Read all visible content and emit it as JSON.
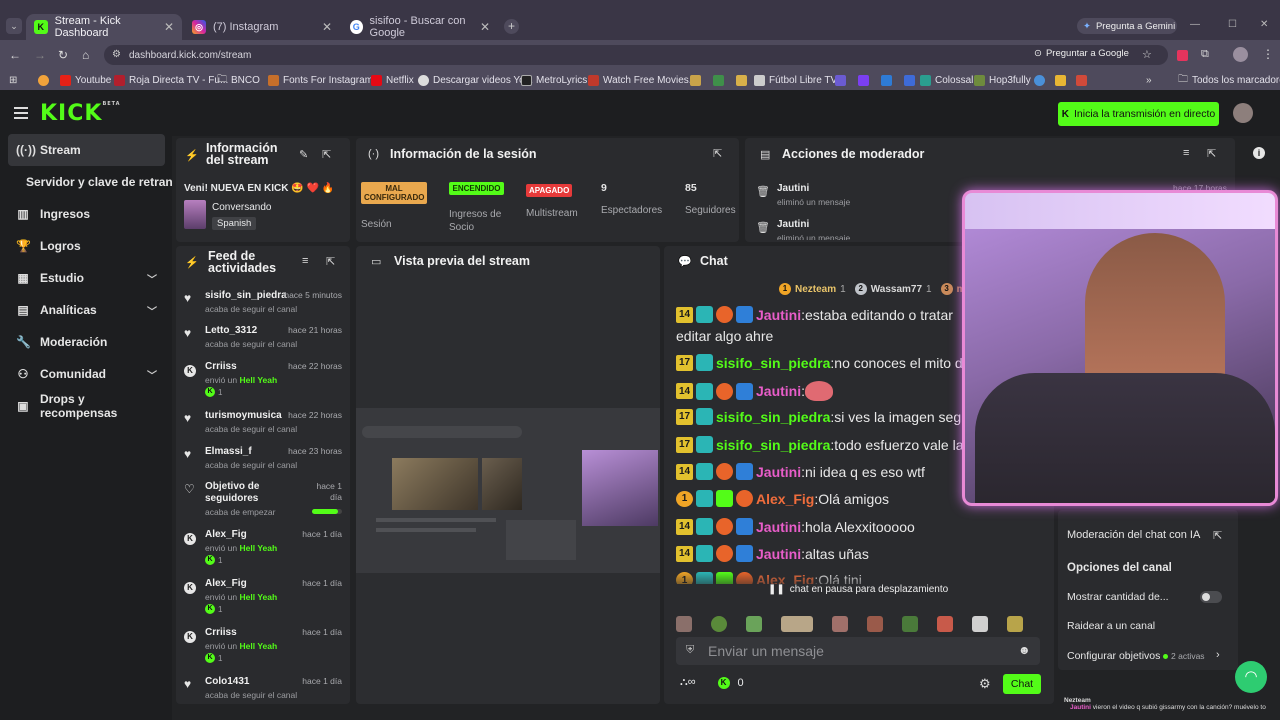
{
  "browser": {
    "tabs": [
      {
        "title": "Stream - Kick Dashboard"
      },
      {
        "title": "(7) Instagram"
      },
      {
        "title": "sisifoo - Buscar con Google"
      }
    ],
    "gemini_button": "Pregunta a Gemini",
    "url": "dashboard.kick.com/stream",
    "ask_google": "Preguntar a Google",
    "bookmarks": [
      "Youtube",
      "Roja Directa TV - Fu...",
      "BNCO",
      "Fonts For Instagram...",
      "Netflix",
      "Descargar videos Yo...",
      "MetroLyrics",
      "Watch Free Movies...",
      "Fútbol Libre TV",
      "Colossal",
      "Hop3fully",
      "Todos los marcadores"
    ]
  },
  "app": {
    "logo": "KICK",
    "logo_beta": "BETA",
    "go_live_button": "Inicia la transmisión en directo",
    "accent": "#53fc18"
  },
  "sidebar": {
    "items": [
      {
        "label": "Stream"
      },
      {
        "label": "Servidor y clave de retransn"
      },
      {
        "label": "Ingresos"
      },
      {
        "label": "Logros"
      },
      {
        "label": "Estudio"
      },
      {
        "label": "Analíticas"
      },
      {
        "label": "Moderación"
      },
      {
        "label": "Comunidad"
      },
      {
        "label": "Drops y recompensas"
      }
    ]
  },
  "stream_info": {
    "title_line1": "Información",
    "title_line2": "del stream",
    "stream_title": "Veni! NUEVA EN KICK 🤩 ❤️ 🔥",
    "category": "Conversando",
    "language": "Spanish"
  },
  "session": {
    "title": "Información de la sesión",
    "stats": [
      {
        "badge": "MAL CONFIGURADO",
        "label": "Sesión"
      },
      {
        "badge": "ENCENDIDO",
        "label": "Ingresos de Socio"
      },
      {
        "badge": "APAGADO",
        "label": "Multistream"
      },
      {
        "value": "9",
        "label": "Espectadores"
      },
      {
        "value": "85",
        "label": "Seguidores"
      }
    ]
  },
  "moderator": {
    "title": "Acciones de moderador",
    "items": [
      {
        "user": "Jautini",
        "action": "eliminó un mensaje",
        "time": "hace 17 horas"
      },
      {
        "user": "Jautini",
        "action": "eliminó un mensaje"
      }
    ]
  },
  "feed": {
    "title_line1": "Feed de",
    "title_line2": "actividades",
    "items": [
      {
        "icon": "heart",
        "name": "sisifo_sin_piedra",
        "time": "hace 5 minutos",
        "sub": "acaba de seguir el canal"
      },
      {
        "icon": "heart",
        "name": "Letto_3312",
        "time": "hace 21 horas",
        "sub": "acaba de seguir el canal"
      },
      {
        "icon": "kick",
        "name": "Crriiss",
        "time": "hace 22 horas",
        "sub_pre": "envió un",
        "sub_hl": "Hell Yeah",
        "count": "1"
      },
      {
        "icon": "heart",
        "name": "turismoymusica",
        "time": "hace 22 horas",
        "sub": "acaba de seguir el canal"
      },
      {
        "icon": "heart",
        "name": "Elmassi_f",
        "time": "hace 23 horas",
        "sub": "acaba de seguir el canal"
      },
      {
        "icon": "heart-outline",
        "name_line1": "Objetivo de",
        "name_line2": "seguidores",
        "time_line1": "hace 1",
        "time_line2": "día",
        "sub": "acaba de empezar",
        "progress": 0.85
      },
      {
        "icon": "kick",
        "name": "Alex_Fig",
        "time": "hace 1 día",
        "sub_pre": "envió un",
        "sub_hl": "Hell Yeah",
        "count": "1"
      },
      {
        "icon": "kick",
        "name": "Alex_Fig",
        "time": "hace 1 día",
        "sub_pre": "envió un",
        "sub_hl": "Hell Yeah",
        "count": "1"
      },
      {
        "icon": "kick",
        "name": "Crriiss",
        "time": "hace 1 día",
        "sub_pre": "envió un",
        "sub_hl": "Hell Yeah",
        "count": "1"
      },
      {
        "icon": "heart",
        "name": "Colo1431",
        "time": "hace 1 día",
        "sub": "acaba de seguir el canal"
      }
    ]
  },
  "preview": {
    "title": "Vista previa del stream"
  },
  "chat": {
    "title": "Chat",
    "top_gifters": [
      {
        "rank": "1",
        "name": "Nezteam",
        "count": "1"
      },
      {
        "rank": "2",
        "name": "Wassam77",
        "count": "1"
      },
      {
        "rank": "3",
        "name": "ma"
      }
    ],
    "messages": [
      {
        "level": "14",
        "user": "Jautini",
        "color": "#e85dc9",
        "text": "estaba editando o tratar",
        "cont": "editar algo ahre"
      },
      {
        "level": "17",
        "user": "sisifo_sin_piedra",
        "color": "#53fc18",
        "text": "no conoces el mito de S"
      },
      {
        "level": "14",
        "user": "Jautini",
        "color": "#e85dc9",
        "text": ""
      },
      {
        "level": "17",
        "user": "sisifo_sin_piedra",
        "color": "#53fc18",
        "text": "si ves la imagen seguro"
      },
      {
        "level": "17",
        "user": "sisifo_sin_piedra",
        "color": "#53fc18",
        "text": "todo esfuerzo vale la pe"
      },
      {
        "level": "14",
        "user": "Jautini",
        "color": "#e85dc9",
        "text": "ni idea q es eso wtf"
      },
      {
        "level": "1",
        "user": "Alex_Fig",
        "color": "#f06d3c",
        "text": "Olá amigos"
      },
      {
        "level": "14",
        "user": "Jautini",
        "color": "#e85dc9",
        "text": "hola Alexxitooooo"
      },
      {
        "level": "14",
        "user": "Jautini",
        "color": "#e85dc9",
        "text": "altas uñas"
      },
      {
        "level": "1",
        "user": "Alex_Fig",
        "color": "#f06d3c",
        "text": "Olá tini"
      }
    ],
    "paused_notice": "chat en pausa para desplazamiento",
    "input_placeholder": "Enviar un mensaje",
    "points": "0",
    "send_button": "Chat"
  },
  "right_panel": {
    "ai_moderation": "Moderación del chat con IA",
    "channel_options": "Opciones del canal",
    "show_count": "Mostrar cantidad de...",
    "raid": "Raidear a un canal",
    "goals": "Configurar objetivos",
    "goals_active": "2 activas"
  },
  "overlay": {
    "line1": "Nezteam",
    "line2_user": "Jautini",
    "line2_text": "vieron el video q subió gissarmy con la canción? muévelo to"
  }
}
